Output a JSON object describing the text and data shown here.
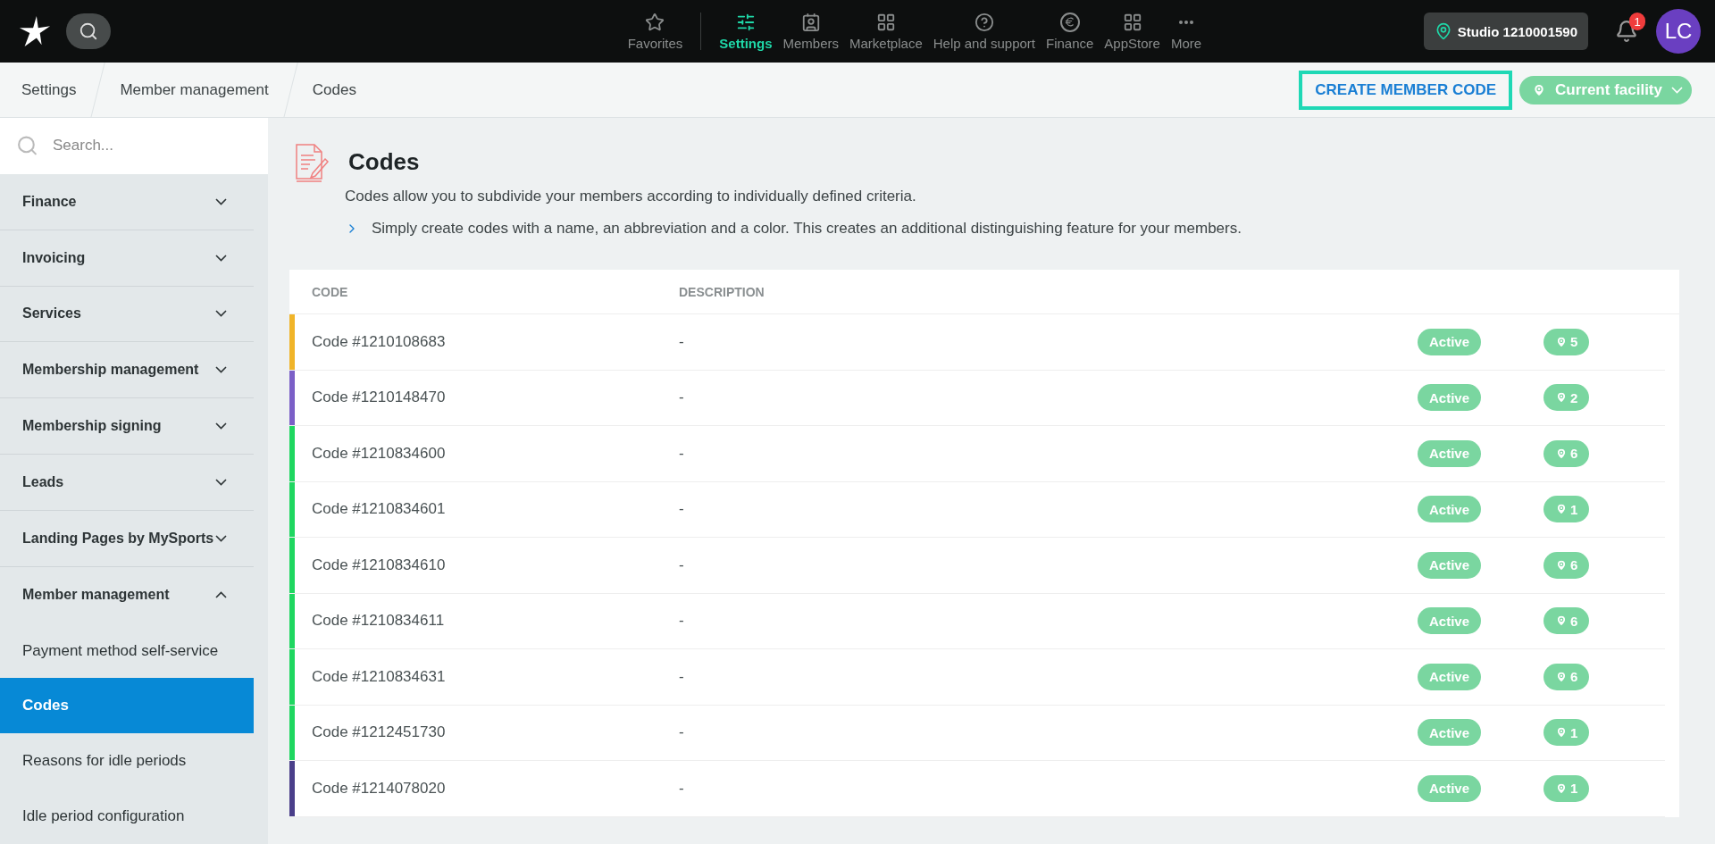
{
  "topbar": {
    "nav": [
      {
        "label": "Favorites",
        "kind": "star",
        "selected": false
      },
      {
        "label": "Settings",
        "kind": "sliders",
        "selected": true
      },
      {
        "label": "Members",
        "kind": "members",
        "selected": false
      },
      {
        "label": "Marketplace",
        "kind": "grid",
        "selected": false
      },
      {
        "label": "Help and support",
        "kind": "help",
        "selected": false
      },
      {
        "label": "Finance",
        "kind": "euro",
        "selected": false
      },
      {
        "label": "AppStore",
        "kind": "grid",
        "selected": false
      },
      {
        "label": "More",
        "kind": "more",
        "selected": false
      }
    ],
    "studio": "Studio 1210001590",
    "notifications": "1",
    "avatar": "LC"
  },
  "breadcrumb": [
    "Settings",
    "Member management",
    "Codes"
  ],
  "actions": {
    "create": "CREATE MEMBER CODE",
    "facility": "Current facility"
  },
  "sidebar": {
    "search": {
      "placeholder": "Search..."
    },
    "items": [
      {
        "label": "Finance",
        "expanded": false
      },
      {
        "label": "Invoicing",
        "expanded": false
      },
      {
        "label": "Services",
        "expanded": false
      },
      {
        "label": "Membership management",
        "expanded": false
      },
      {
        "label": "Membership signing",
        "expanded": false
      },
      {
        "label": "Leads",
        "expanded": false
      },
      {
        "label": "Landing Pages by MySports",
        "expanded": false
      },
      {
        "label": "Member management",
        "expanded": true,
        "children": [
          {
            "label": "Payment method self-service",
            "selected": false
          },
          {
            "label": "Codes",
            "selected": true
          },
          {
            "label": "Reasons for idle periods",
            "selected": false
          },
          {
            "label": "Idle period configuration",
            "selected": false
          }
        ]
      }
    ]
  },
  "page": {
    "title": "Codes",
    "intro": "Codes allow you to subdivide your members according to individually defined criteria.",
    "hint": "Simply create codes with a name, an abbreviation and a color. This creates an additional distinguishing feature for your members."
  },
  "table": {
    "columns": [
      "CODE",
      "DESCRIPTION"
    ],
    "rows": [
      {
        "code": "Code #1210108683",
        "description": "-",
        "status": "Active",
        "locations": "5",
        "color": "#f0b429"
      },
      {
        "code": "Code #1210148470",
        "description": "-",
        "status": "Active",
        "locations": "2",
        "color": "#7b5fc7"
      },
      {
        "code": "Code #1210834600",
        "description": "-",
        "status": "Active",
        "locations": "6",
        "color": "#1ed760"
      },
      {
        "code": "Code #1210834601",
        "description": "-",
        "status": "Active",
        "locations": "1",
        "color": "#1ed760"
      },
      {
        "code": "Code #1210834610",
        "description": "-",
        "status": "Active",
        "locations": "6",
        "color": "#1ed760"
      },
      {
        "code": "Code #1210834611",
        "description": "-",
        "status": "Active",
        "locations": "6",
        "color": "#1ed760"
      },
      {
        "code": "Code #1210834631",
        "description": "-",
        "status": "Active",
        "locations": "6",
        "color": "#1ed760"
      },
      {
        "code": "Code #1212451730",
        "description": "-",
        "status": "Active",
        "locations": "1",
        "color": "#1ed760"
      },
      {
        "code": "Code #1214078020",
        "description": "-",
        "status": "Active",
        "locations": "1",
        "color": "#4a3f8a"
      }
    ]
  }
}
